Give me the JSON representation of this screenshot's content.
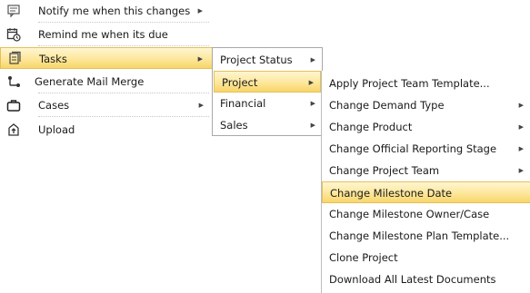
{
  "menu1": {
    "items": [
      {
        "label": "Notify me when this changes",
        "icon": "comment-icon"
      },
      {
        "label": "Remind me when its due",
        "icon": "calendar-clock-icon"
      },
      {
        "label": "Tasks",
        "icon": "tasks-icon"
      },
      {
        "label": "Generate Mail Merge",
        "icon": "mail-merge-icon"
      },
      {
        "label": "Cases",
        "icon": "briefcase-icon"
      },
      {
        "label": "Upload",
        "icon": "upload-icon"
      }
    ]
  },
  "menu2": {
    "items": [
      {
        "label": "Project Status"
      },
      {
        "label": "Project"
      },
      {
        "label": "Financial"
      },
      {
        "label": "Sales"
      }
    ]
  },
  "menu3": {
    "items": [
      {
        "label": "Apply Project Team Template..."
      },
      {
        "label": "Change Demand Type"
      },
      {
        "label": "Change Product"
      },
      {
        "label": "Change Official Reporting Stage"
      },
      {
        "label": "Change Project Team"
      },
      {
        "label": "Change Milestone Date"
      },
      {
        "label": "Change Milestone Owner/Case"
      },
      {
        "label": "Change Milestone Plan Template..."
      },
      {
        "label": "Clone Project"
      },
      {
        "label": "Download All Latest Documents"
      }
    ]
  },
  "colors": {
    "highlight": "#fde79b",
    "highlight_border": "#e5c05a"
  }
}
